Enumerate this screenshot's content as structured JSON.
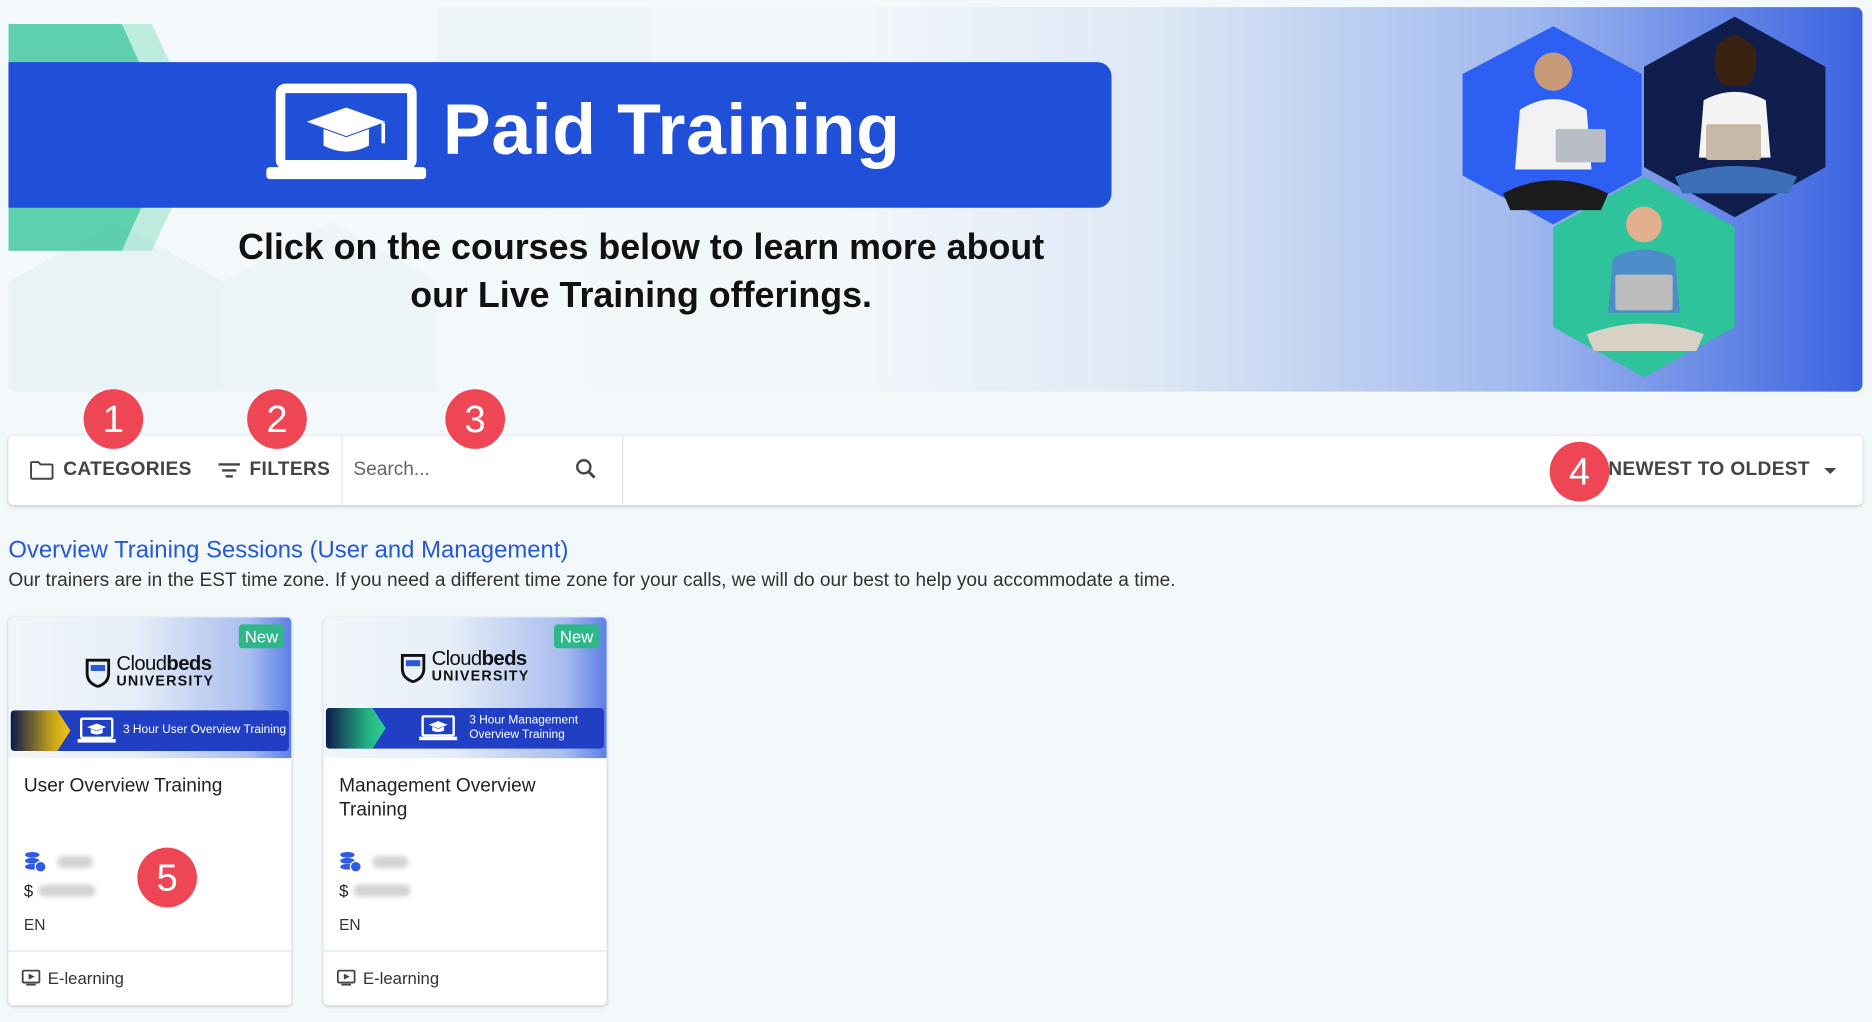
{
  "banner": {
    "title": "Paid Training",
    "subtitle_line1": "Click on the courses below to learn more about",
    "subtitle_line2": "our Live Training offerings."
  },
  "toolbar": {
    "categories_label": "CATEGORIES",
    "filters_label": "FILTERS",
    "search_placeholder": "Search...",
    "sort_label": "NEWEST TO OLDEST"
  },
  "markers": [
    "1",
    "2",
    "3",
    "4",
    "5"
  ],
  "section": {
    "title": "Overview Training Sessions (User and Management)",
    "description": "Our trainers are in the EST time zone. If you need a different time zone for your calls, we will do our best to help you accommodate a time."
  },
  "cards": [
    {
      "badge": "New",
      "logo_line1_a": "Cloud",
      "logo_line1_b": "beds",
      "logo_line2": "UNIVERSITY",
      "strip_text": "3 Hour User Overview Training",
      "title": "User Overview Training",
      "currency": "$",
      "language": "EN",
      "type": "E-learning"
    },
    {
      "badge": "New",
      "logo_line1_a": "Cloud",
      "logo_line1_b": "beds",
      "logo_line2": "UNIVERSITY",
      "strip_text": "3 Hour Management Overview Training",
      "title": "Management Overview Training",
      "currency": "$",
      "language": "EN",
      "type": "E-learning"
    }
  ],
  "colors": {
    "accent_blue": "#2150d8",
    "link_blue": "#2458d6",
    "marker_red": "#ee4654",
    "badge_green": "#2fb78a"
  }
}
